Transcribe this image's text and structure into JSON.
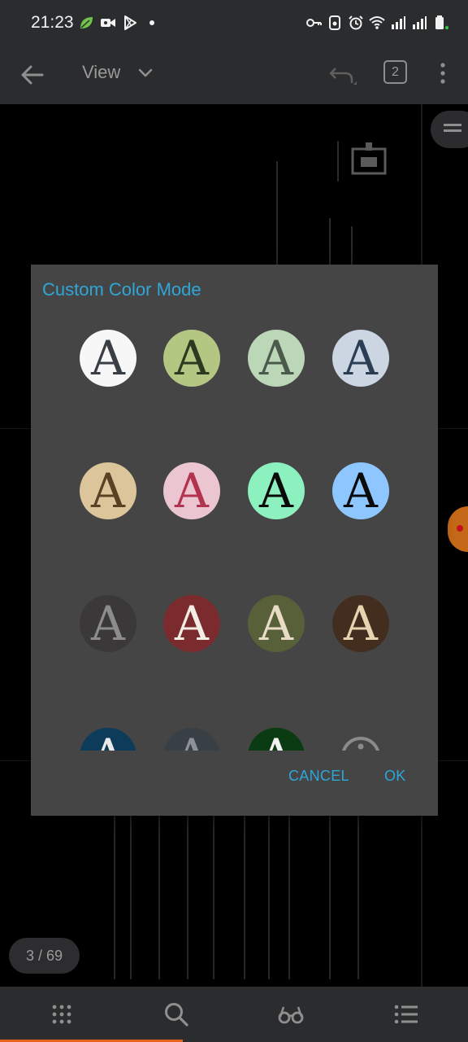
{
  "status_bar": {
    "time": "21:23",
    "left_icons": [
      "leaf-icon",
      "video-icon",
      "play-store-icon",
      "dot-icon"
    ],
    "right_icons": [
      "key-icon",
      "wallet-icon",
      "alarm-icon",
      "wifi-icon",
      "signal-icon",
      "signal-icon",
      "battery-icon"
    ]
  },
  "toolbar": {
    "back_icon": "arrow-left-icon",
    "mode_label": "View",
    "dropdown_icon": "chevron-down-icon",
    "undo_icon": "undo-icon",
    "pages_count": "2",
    "more_icon": "more-vert-icon"
  },
  "document": {
    "page_counter": "3 / 69",
    "side_icon": "menu-icon"
  },
  "dialog": {
    "title": "Custom Color Mode",
    "glyph": "A",
    "swatches": [
      {
        "name": "white",
        "bg": "#f7f7f7",
        "fg": "#3a3f45"
      },
      {
        "name": "olive-green",
        "bg": "#b3c783",
        "fg": "#2d3a22"
      },
      {
        "name": "sage",
        "bg": "#bcd6b8",
        "fg": "#4b5b4b"
      },
      {
        "name": "light-blue-gray",
        "bg": "#ccd6e2",
        "fg": "#2c3e55"
      },
      {
        "name": "sepia",
        "bg": "#dcc49b",
        "fg": "#5b4124"
      },
      {
        "name": "pink",
        "bg": "#ebc5cf",
        "fg": "#b2334f"
      },
      {
        "name": "mint",
        "bg": "#8cf0bf",
        "fg": "#0a0a0a"
      },
      {
        "name": "sky-blue",
        "bg": "#8ec7ff",
        "fg": "#0b0b0b"
      },
      {
        "name": "dark-gray",
        "bg": "#3a3838",
        "fg": "#8c8c8c"
      },
      {
        "name": "maroon",
        "bg": "#7b2b2d",
        "fg": "#f3ede6"
      },
      {
        "name": "dark-olive",
        "bg": "#58603a",
        "fg": "#e9dcc6"
      },
      {
        "name": "dark-brown",
        "bg": "#432d1f",
        "fg": "#e7d3b0"
      },
      {
        "name": "navy",
        "bg": "#0d3b5a",
        "fg": "#eaeaea"
      },
      {
        "name": "slate",
        "bg": "#394045",
        "fg": "#8c9297"
      },
      {
        "name": "forest",
        "bg": "#0b3b12",
        "fg": "#f2f2f2"
      },
      {
        "name": "custom",
        "bg": "#454545",
        "fg": "#8a8a8a",
        "is_add": true
      }
    ],
    "cancel_label": "CANCEL",
    "ok_label": "OK"
  },
  "bottom_bar": {
    "items": [
      "grid-icon",
      "search-icon",
      "glasses-icon",
      "list-icon"
    ]
  },
  "colors": {
    "accent": "#2fa6d8",
    "progress": "#e8641e",
    "chrome": "#2b2c2e",
    "dialog_bg": "#454545"
  }
}
